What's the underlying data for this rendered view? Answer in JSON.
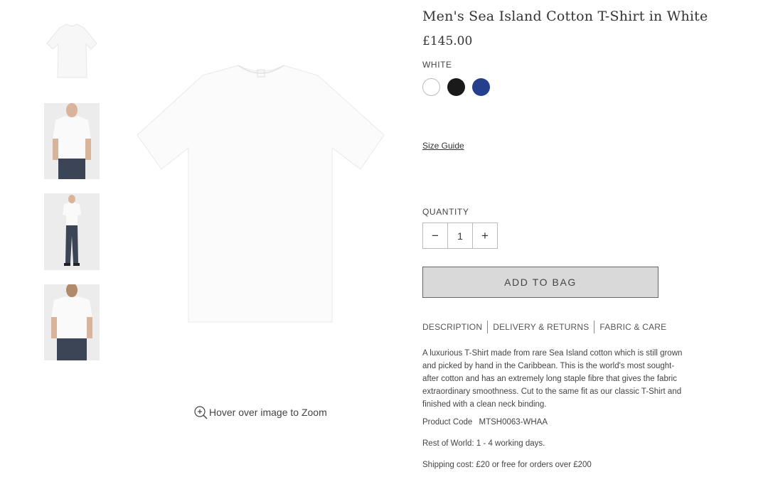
{
  "product": {
    "title": "Men's Sea Island Cotton T-Shirt in White",
    "price": "£145.00",
    "color_name": "WHITE",
    "swatches": [
      {
        "name": "White",
        "color": "#ffffff"
      },
      {
        "name": "Black",
        "color": "#1a1a1a"
      },
      {
        "name": "Navy",
        "color": "#253f8c"
      }
    ]
  },
  "size_guide_label": "Size Guide",
  "quantity": {
    "label": "QUANTITY",
    "value": "1",
    "minus": "−",
    "plus": "+"
  },
  "add_to_bag_label": "ADD TO BAG",
  "tabs": [
    "DESCRIPTION",
    "DELIVERY & RETURNS",
    "FABRIC & CARE"
  ],
  "description": "A luxurious T-Shirt made from rare Sea Island cotton which is still grown and picked by hand in the Caribbean. This is the world's most sought-after cotton and has an extremely long staple fibre that gives the fabric extraordinary smoothness. Cut to the same fit as our classic T-Shirt and finished with a clean neck binding.",
  "product_code": {
    "label": "Product Code",
    "value": "MTSH0063-WHAA"
  },
  "delivery_text": "Rest of World: 1 - 4 working days.",
  "shipping_text": "Shipping cost: £20 or free for orders over £200",
  "zoom_hint": "Hover over image to Zoom",
  "colors": {
    "accent_navy": "#253f8c",
    "button_bg": "#d9d9da"
  }
}
